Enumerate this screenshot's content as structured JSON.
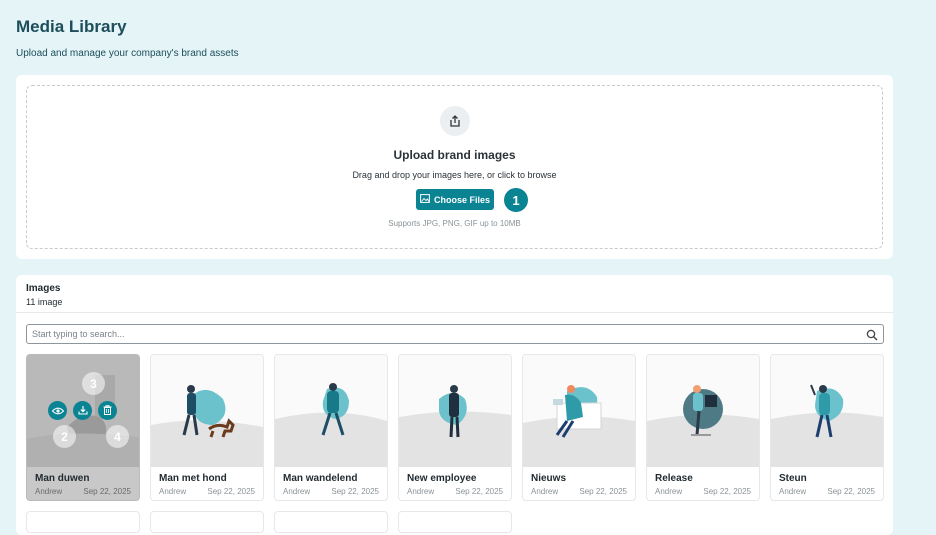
{
  "header": {
    "title": "Media Library",
    "subtitle": "Upload and manage your company's brand assets"
  },
  "upload": {
    "icon": "upload-icon",
    "title": "Upload brand images",
    "subtitle": "Drag and drop your images here, or click to browse",
    "button_label": "Choose Files",
    "button_icon": "image-icon",
    "hint": "Supports JPG, PNG, GIF up to 10MB",
    "step_badge": "1"
  },
  "images": {
    "title": "Images",
    "count": "11 image",
    "search_placeholder": "Start typing to search...",
    "items": [
      {
        "name": "Man duwen",
        "author": "Andrew",
        "date": "Sep 22, 2025"
      },
      {
        "name": "Man met hond",
        "author": "Andrew",
        "date": "Sep 22, 2025"
      },
      {
        "name": "Man wandelend",
        "author": "Andrew",
        "date": "Sep 22, 2025"
      },
      {
        "name": "New employee",
        "author": "Andrew",
        "date": "Sep 22, 2025"
      },
      {
        "name": "Nieuws",
        "author": "Andrew",
        "date": "Sep 22, 2025"
      },
      {
        "name": "Release",
        "author": "Andrew",
        "date": "Sep 22, 2025"
      },
      {
        "name": "Steun",
        "author": "Andrew",
        "date": "Sep 22, 2025"
      }
    ],
    "overlay_actions": [
      "eye-icon",
      "download-icon",
      "trash-icon"
    ],
    "overlay_badges": [
      "3",
      "2",
      "4"
    ]
  },
  "colors": {
    "accent": "#0a8393",
    "background": "#e4f4f7",
    "title": "#1d4e5c"
  }
}
